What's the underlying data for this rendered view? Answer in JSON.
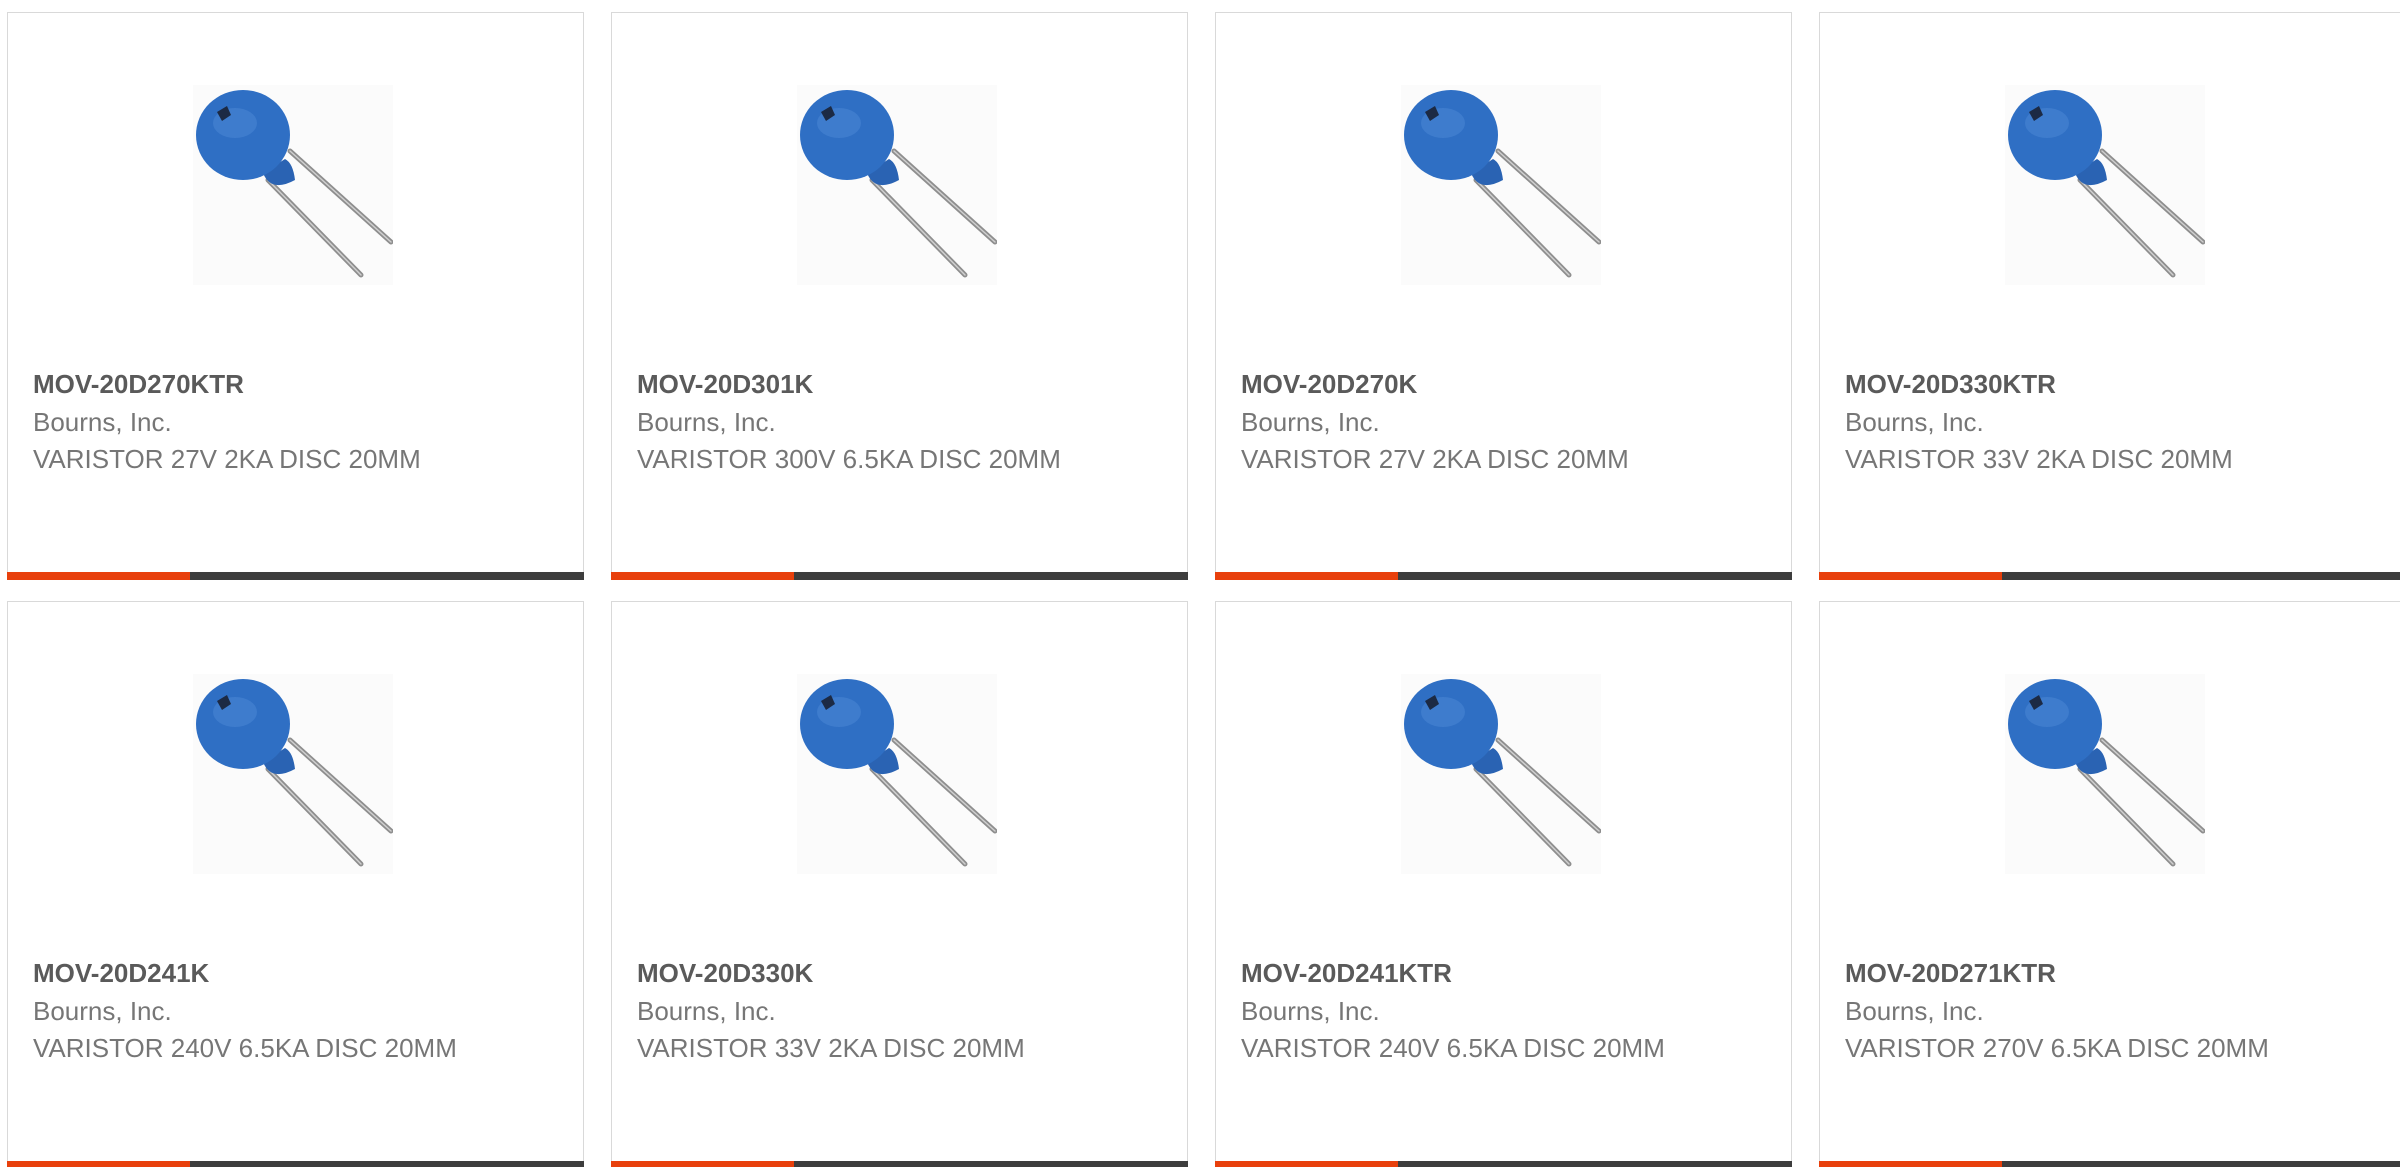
{
  "colors": {
    "accent": "#e8400c",
    "bar_dark": "#3d3d3d",
    "varistor_blue": "#2f6fc4",
    "title_text": "#5a5a5a",
    "body_text": "#767676"
  },
  "product_icon": "varistor-disc-icon",
  "products": [
    {
      "part_number": "MOV-20D270KTR",
      "manufacturer": "Bourns, Inc.",
      "description": "VARISTOR 27V 2KA DISC 20MM"
    },
    {
      "part_number": "MOV-20D301K",
      "manufacturer": "Bourns, Inc.",
      "description": "VARISTOR 300V 6.5KA DISC 20MM"
    },
    {
      "part_number": "MOV-20D270K",
      "manufacturer": "Bourns, Inc.",
      "description": "VARISTOR 27V 2KA DISC 20MM"
    },
    {
      "part_number": "MOV-20D330KTR",
      "manufacturer": "Bourns, Inc.",
      "description": "VARISTOR 33V 2KA DISC 20MM"
    },
    {
      "part_number": "MOV-20D241K",
      "manufacturer": "Bourns, Inc.",
      "description": "VARISTOR 240V 6.5KA DISC 20MM"
    },
    {
      "part_number": "MOV-20D330K",
      "manufacturer": "Bourns, Inc.",
      "description": "VARISTOR 33V 2KA DISC 20MM"
    },
    {
      "part_number": "MOV-20D241KTR",
      "manufacturer": "Bourns, Inc.",
      "description": "VARISTOR 240V 6.5KA DISC 20MM"
    },
    {
      "part_number": "MOV-20D271KTR",
      "manufacturer": "Bourns, Inc.",
      "description": "VARISTOR 270V 6.5KA DISC 20MM"
    }
  ]
}
